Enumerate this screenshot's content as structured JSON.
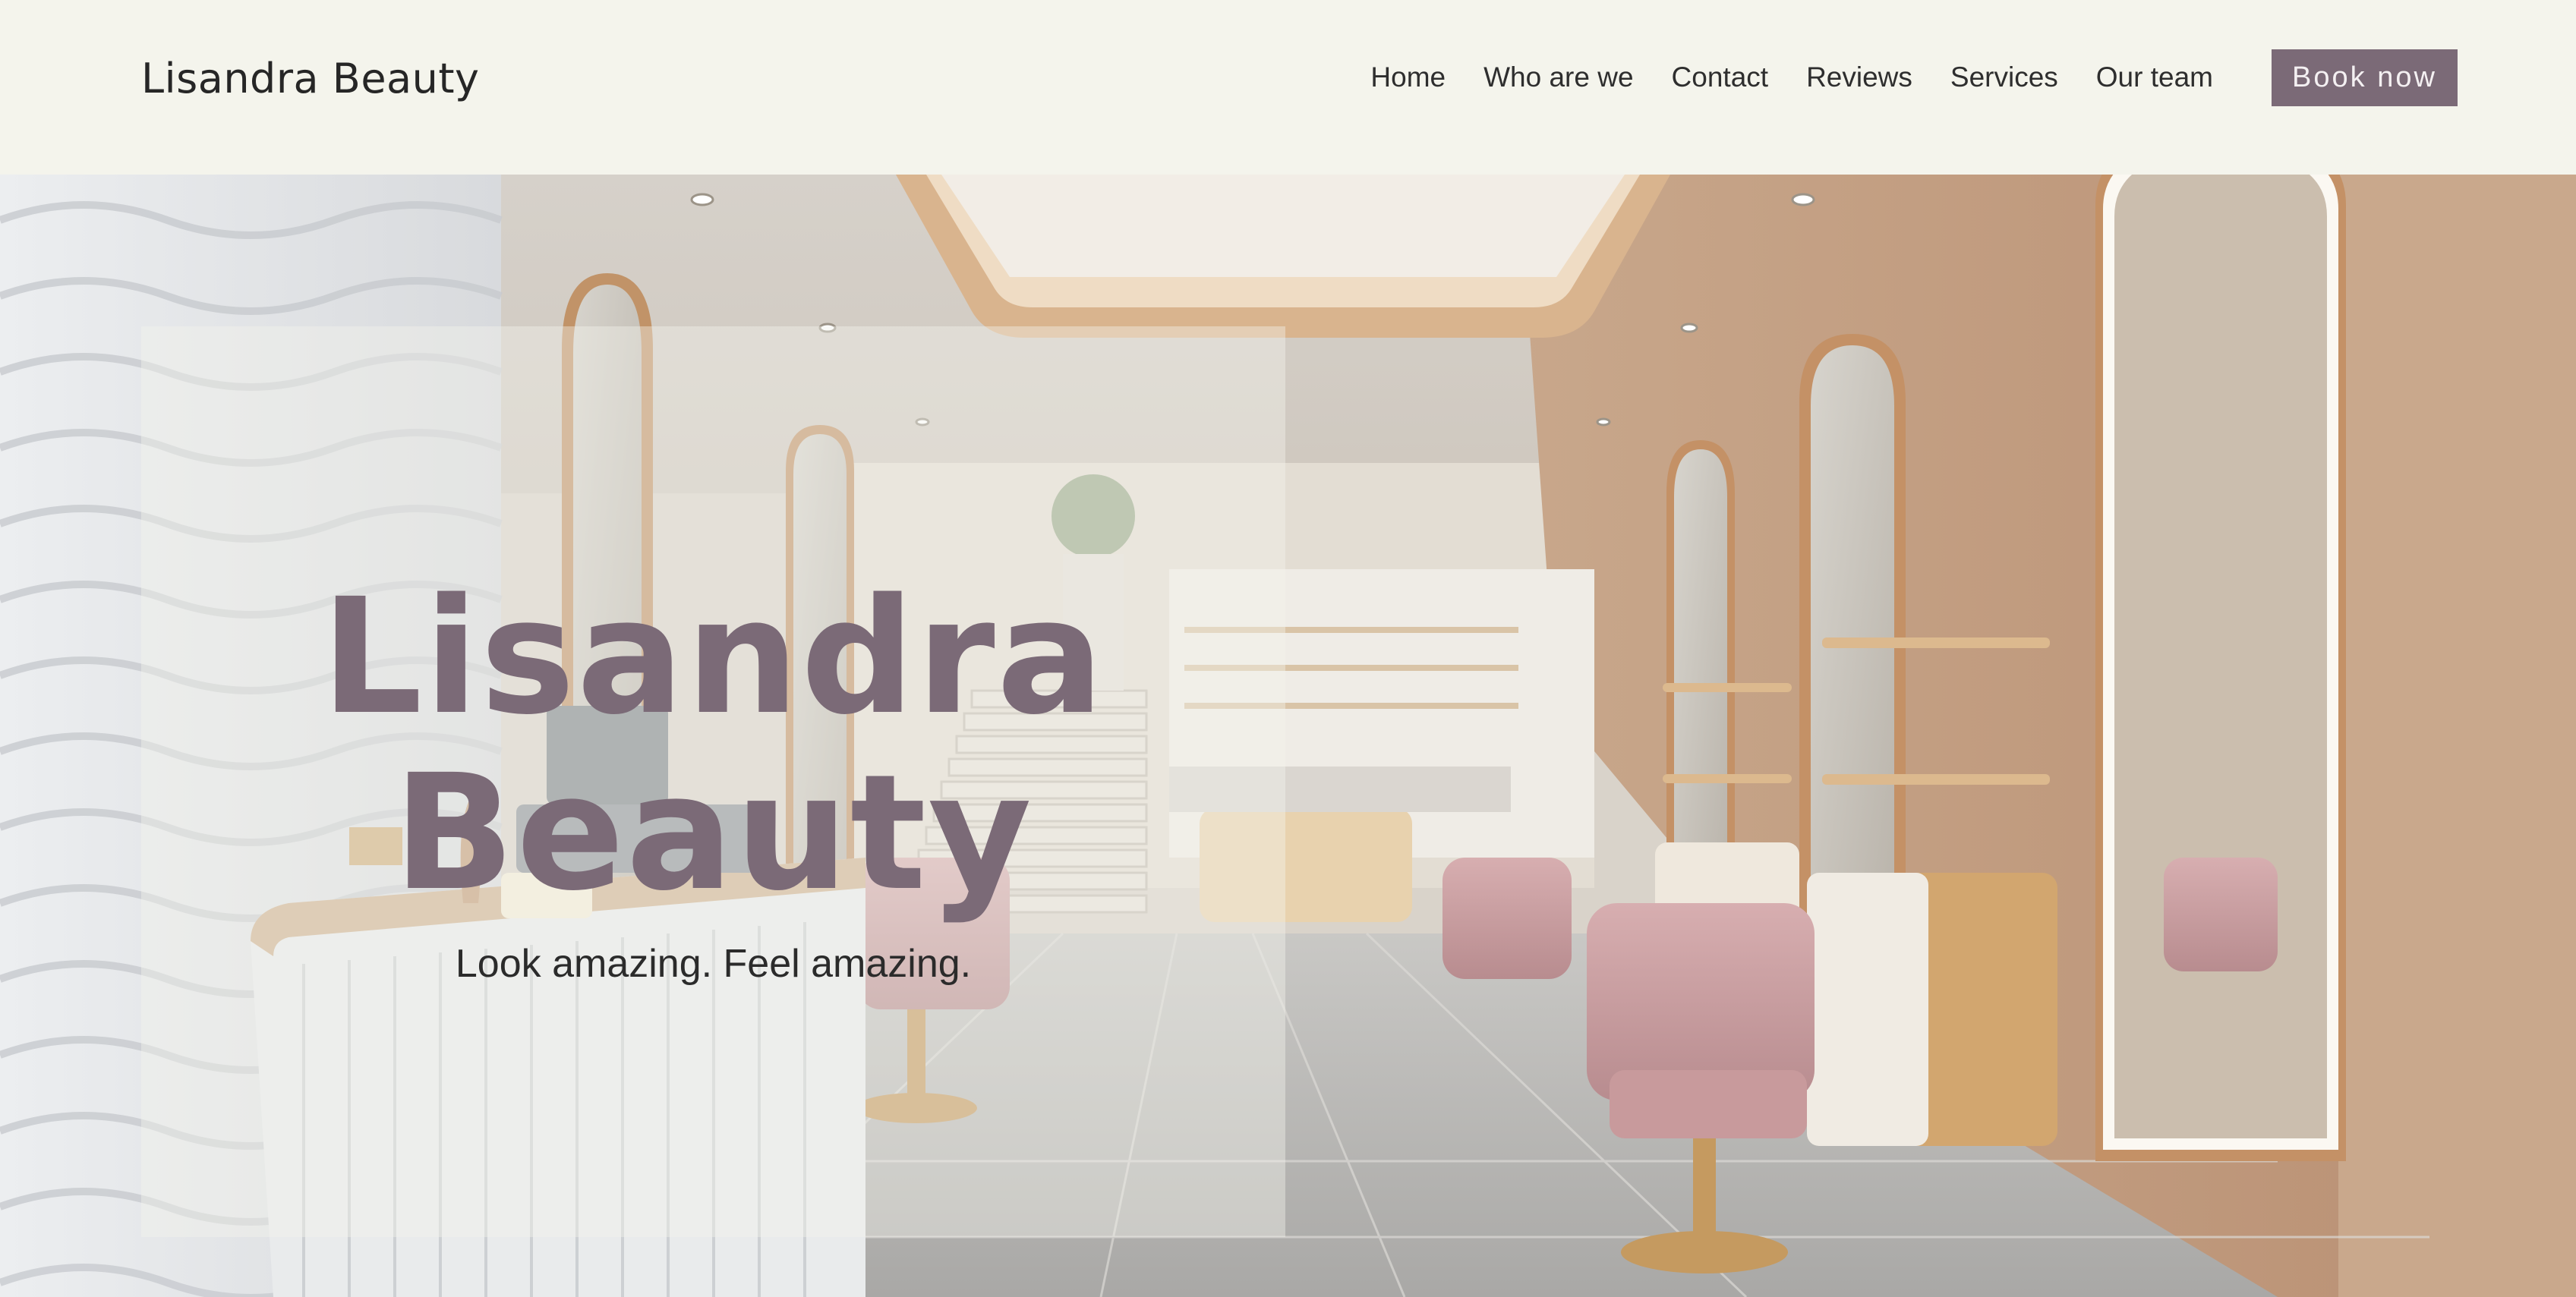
{
  "header": {
    "brand": "Lisandra Beauty",
    "nav": [
      "Home",
      "Who are we",
      "Contact",
      "Reviews",
      "Services",
      "Our team"
    ],
    "cta": "Book now"
  },
  "hero": {
    "title_line1": "Lisandra",
    "title_line2": "Beauty",
    "subtitle": "Look amazing. Feel amazing.",
    "image_icon": "salon-interior-photo"
  },
  "colors": {
    "background": "#f4f4ec",
    "accent": "#7b6a77",
    "text": "#262626"
  }
}
